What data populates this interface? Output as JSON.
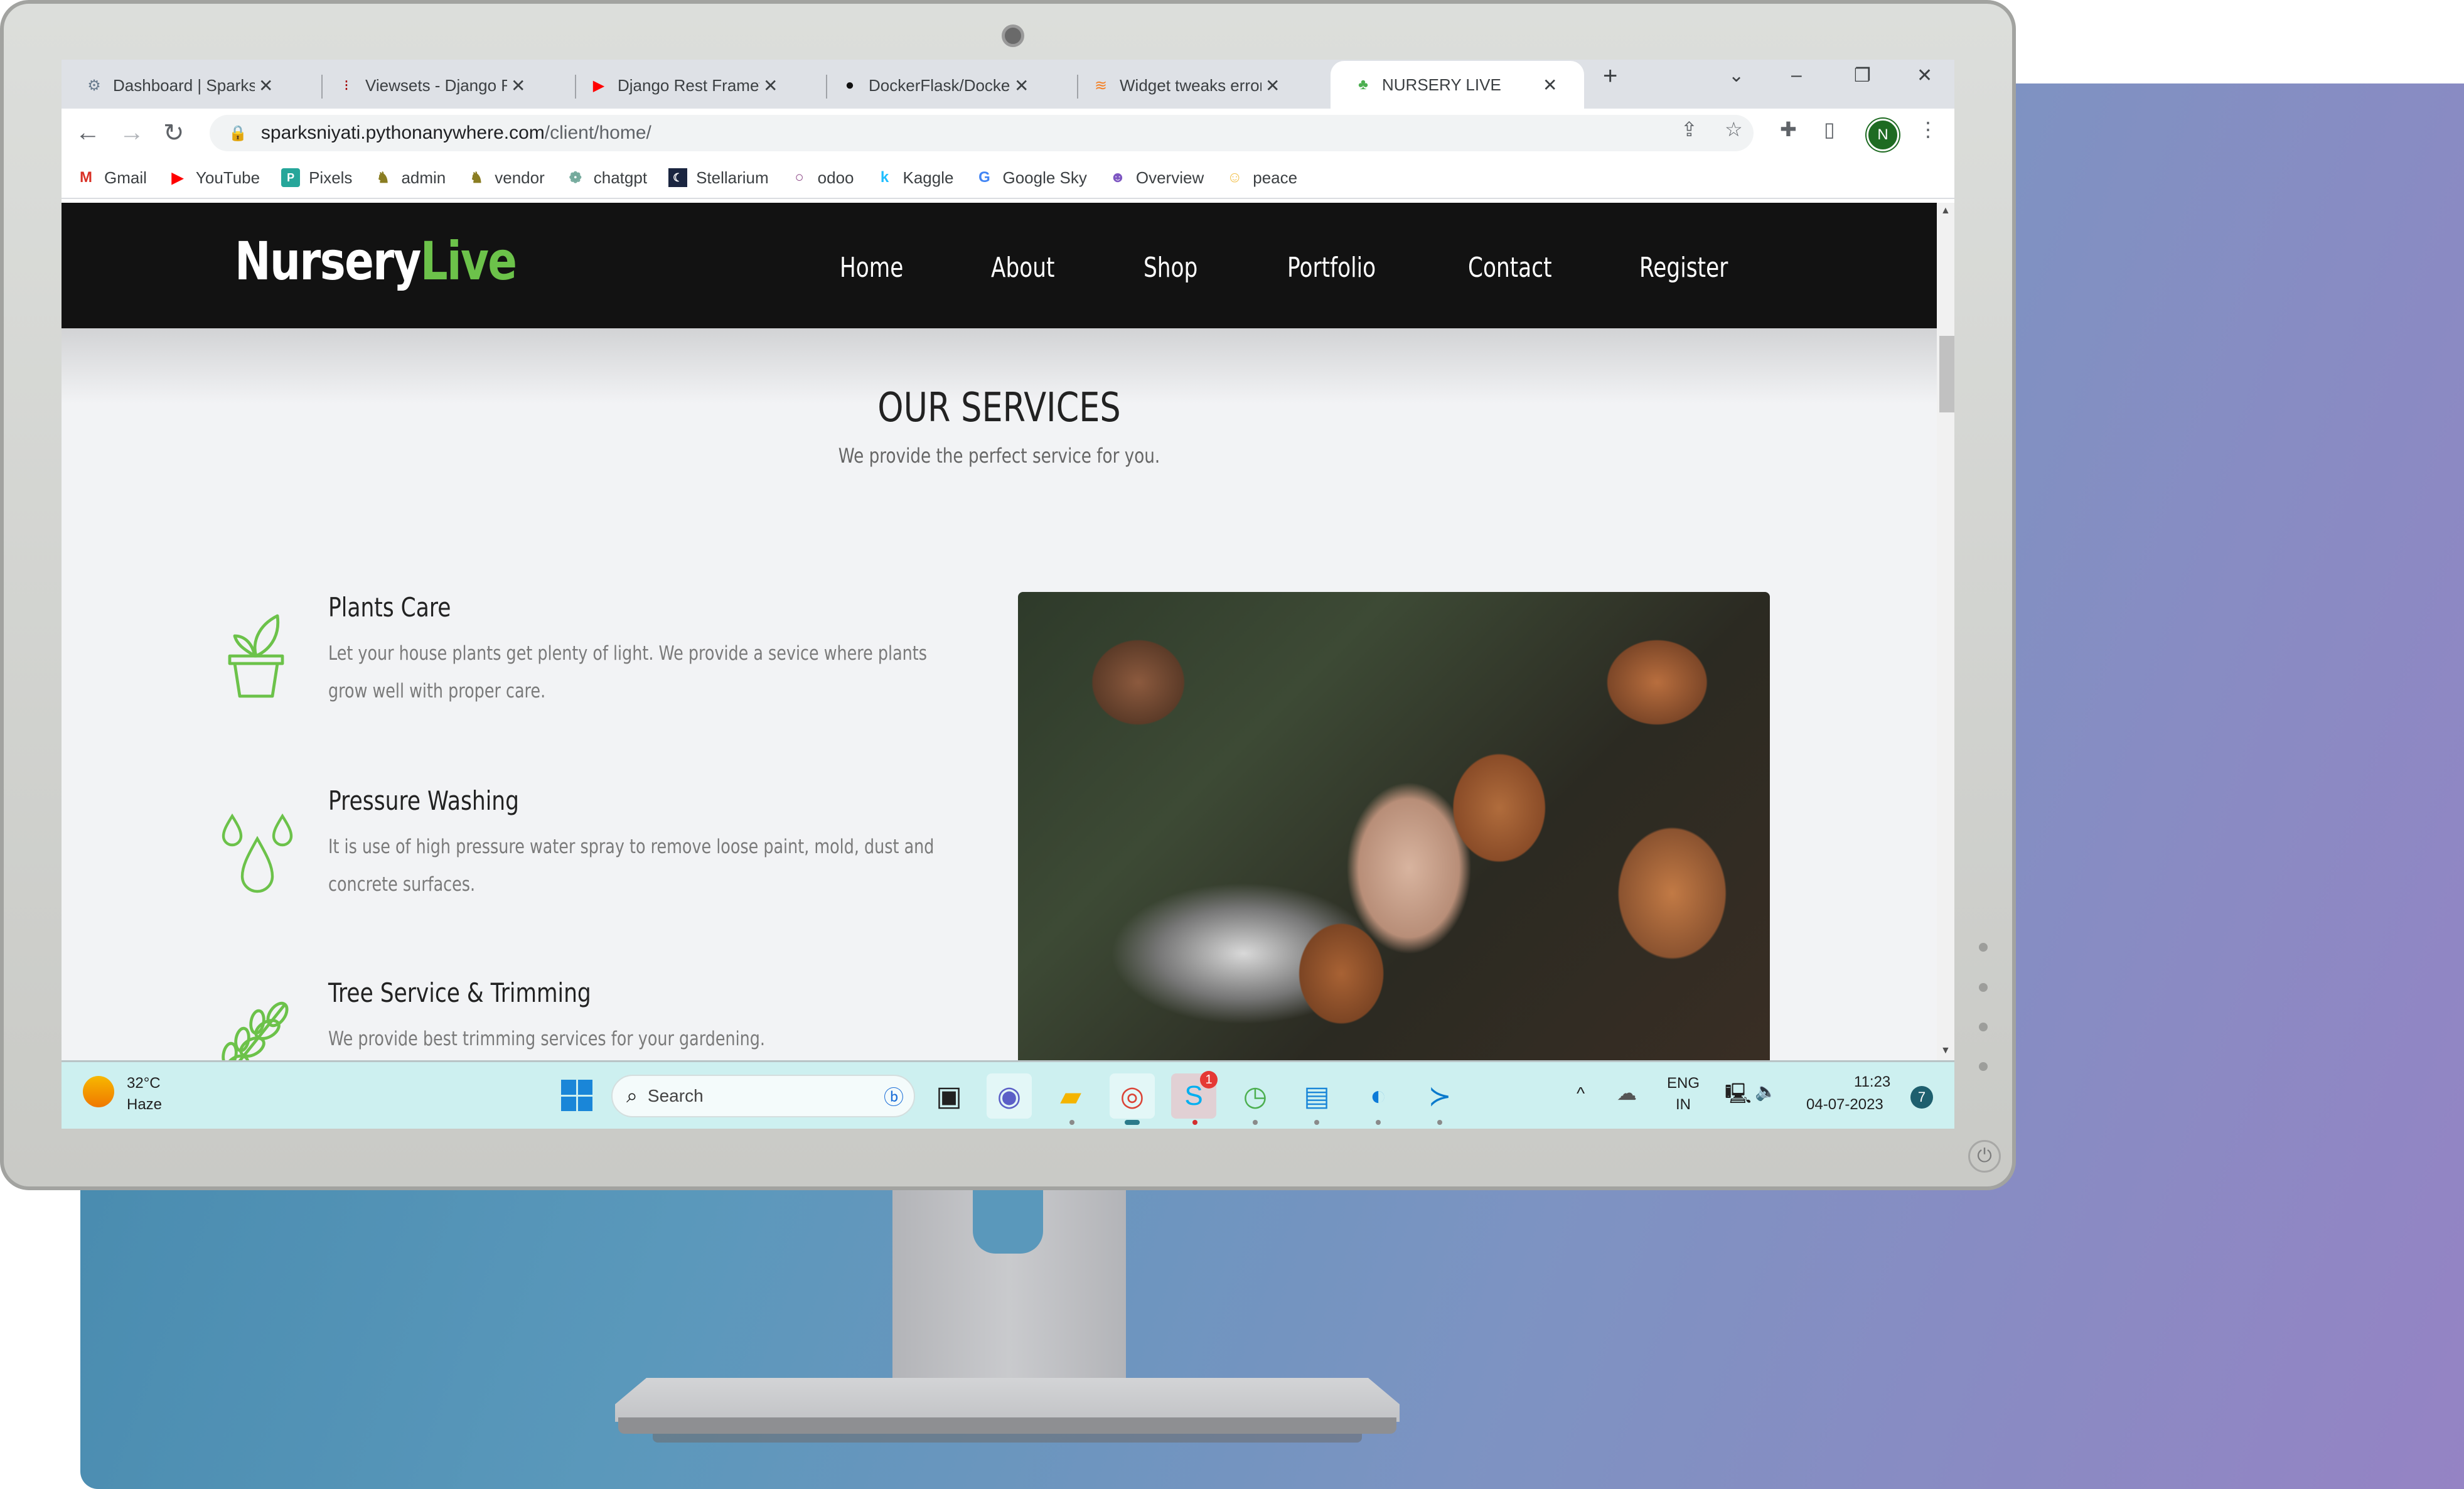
{
  "browser": {
    "tabs": [
      {
        "title": "Dashboard | SparksTo",
        "icon": "dashboard-favicon",
        "active": false
      },
      {
        "title": "Viewsets - Django RES",
        "icon": "django-rest-favicon",
        "active": false
      },
      {
        "title": "Django Rest Framewo",
        "icon": "youtube-favicon",
        "active": false
      },
      {
        "title": "DockerFlask/Dockerfil",
        "icon": "github-favicon",
        "active": false
      },
      {
        "title": "Widget tweaks error I",
        "icon": "stackoverflow-favicon",
        "active": false
      },
      {
        "title": "NURSERY LIVE",
        "icon": "clover-favicon",
        "active": true
      }
    ],
    "new_tab": "+",
    "window_controls": {
      "dropdown": "⌄",
      "minimize": "–",
      "restore": "❐",
      "close": "✕"
    },
    "url": {
      "host": "sparksniyati.pythonanywhere.com",
      "path": "/client/home/"
    },
    "profile_initial": "N",
    "bookmarks": [
      {
        "label": "Gmail",
        "icon": "gmail-icon"
      },
      {
        "label": "YouTube",
        "icon": "youtube-icon"
      },
      {
        "label": "Pixels",
        "icon": "pixels-icon"
      },
      {
        "label": "admin",
        "icon": "admin-icon"
      },
      {
        "label": "vendor",
        "icon": "vendor-icon"
      },
      {
        "label": "chatgpt",
        "icon": "chatgpt-icon"
      },
      {
        "label": "Stellarium",
        "icon": "stellarium-icon"
      },
      {
        "label": "odoo",
        "icon": "odoo-icon"
      },
      {
        "label": "Kaggle",
        "icon": "kaggle-icon"
      },
      {
        "label": "Google Sky",
        "icon": "google-icon"
      },
      {
        "label": "Overview",
        "icon": "overview-icon"
      },
      {
        "label": "peace",
        "icon": "peace-icon"
      }
    ]
  },
  "site": {
    "logo": {
      "part1": "Nursery",
      "part2": "Live"
    },
    "nav": [
      "Home",
      "About",
      "Shop",
      "Portfolio",
      "Contact",
      "Register"
    ],
    "section_title": "OUR SERVICES",
    "section_subtitle": "We provide the perfect service for you.",
    "services": [
      {
        "title": "Plants Care",
        "icon": "potted-plant-icon",
        "desc": "Let your house plants get plenty of light. We provide a sevice where plants grow well with proper care."
      },
      {
        "title": "Pressure Washing",
        "icon": "water-drops-icon",
        "desc": "It is use of high pressure water spray to remove loose paint, mold, dust and concrete surfaces."
      },
      {
        "title": "Tree Service & Trimming",
        "icon": "leaf-branch-icon",
        "desc": "We provide best trimming services for your gardening."
      }
    ],
    "scroll_top": "^",
    "accent_color": "#6cc24a"
  },
  "taskbar": {
    "weather": {
      "temp": "32°C",
      "condition": "Haze"
    },
    "search_placeholder": "Search",
    "apps": [
      "task-view",
      "teams",
      "file-explorer",
      "chrome",
      "skype",
      "clock",
      "notepad",
      "edge",
      "vscode"
    ],
    "skype_badge": "1",
    "lang": {
      "line1": "ENG",
      "line2": "IN"
    },
    "time": "11:23",
    "date": "04-07-2023",
    "notification_count": "7"
  }
}
